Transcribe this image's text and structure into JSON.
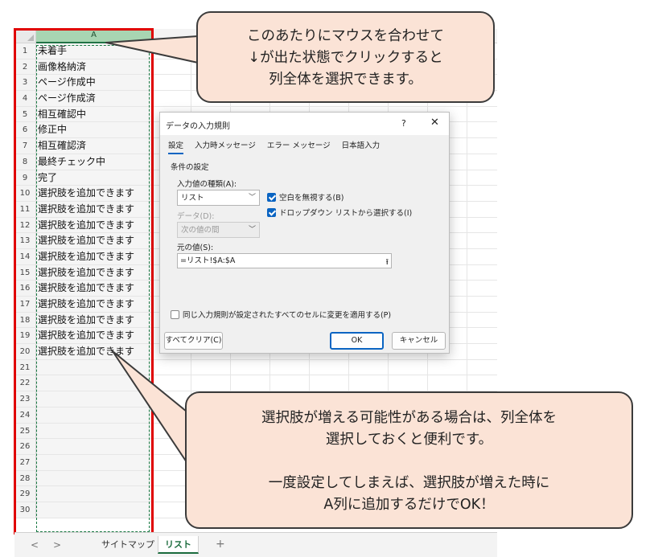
{
  "spreadsheet": {
    "column_header": "A",
    "rows": [
      {
        "num": "1",
        "value": "未着手"
      },
      {
        "num": "2",
        "value": "画像格納済"
      },
      {
        "num": "3",
        "value": "ページ作成中"
      },
      {
        "num": "4",
        "value": "ページ作成済"
      },
      {
        "num": "5",
        "value": "相互確認中"
      },
      {
        "num": "6",
        "value": "修正中"
      },
      {
        "num": "7",
        "value": "相互確認済"
      },
      {
        "num": "8",
        "value": "最終チェック中"
      },
      {
        "num": "9",
        "value": "完了"
      },
      {
        "num": "10",
        "value": "選択肢を追加できます"
      },
      {
        "num": "11",
        "value": "選択肢を追加できます"
      },
      {
        "num": "12",
        "value": "選択肢を追加できます"
      },
      {
        "num": "13",
        "value": "選択肢を追加できます"
      },
      {
        "num": "14",
        "value": "選択肢を追加できます"
      },
      {
        "num": "15",
        "value": "選択肢を追加できます"
      },
      {
        "num": "16",
        "value": "選択肢を追加できます"
      },
      {
        "num": "17",
        "value": "選択肢を追加できます"
      },
      {
        "num": "18",
        "value": "選択肢を追加できます"
      },
      {
        "num": "19",
        "value": "選択肢を追加できます"
      },
      {
        "num": "20",
        "value": "選択肢を追加できます"
      },
      {
        "num": "21",
        "value": ""
      },
      {
        "num": "22",
        "value": ""
      },
      {
        "num": "23",
        "value": ""
      },
      {
        "num": "24",
        "value": ""
      },
      {
        "num": "25",
        "value": ""
      },
      {
        "num": "26",
        "value": ""
      },
      {
        "num": "27",
        "value": ""
      },
      {
        "num": "28",
        "value": ""
      },
      {
        "num": "29",
        "value": ""
      },
      {
        "num": "30",
        "value": ""
      }
    ],
    "sheet_tabs": {
      "prev": "<",
      "next": ">",
      "tab1": "サイトマップ",
      "tab2": "リスト",
      "add": "+"
    }
  },
  "dialog": {
    "title": "データの入力規則",
    "help": "?",
    "close": "✕",
    "tabs": [
      "設定",
      "入力時メッセージ",
      "エラー メッセージ",
      "日本語入力"
    ],
    "group_label": "条件の設定",
    "allow_label": "入力値の種類(A):",
    "allow_value": "リスト",
    "ignore_blank": "空白を無視する(B)",
    "in_cell_dropdown": "ドロップダウン リストから選択する(I)",
    "data_label": "データ(D):",
    "data_value": "次の値の間",
    "source_label": "元の値(S):",
    "source_value": "=リスト!$A:$A",
    "apply_all": "同じ入力規則が設定されたすべてのセルに変更を適用する(P)",
    "clear_all": "すべてクリア(C)",
    "ok": "OK",
    "cancel": "キャンセル"
  },
  "callouts": {
    "top": [
      "このあたりにマウスを合わせて",
      "↓が出た状態でクリックすると",
      "列全体を選択できます。"
    ],
    "bottom": [
      "選択肢が増える可能性がある場合は、列全体を",
      "選択しておくと便利です。",
      "",
      "一度設定してしまえば、選択肢が増えた時に",
      "A列に追加するだけでOK！"
    ]
  },
  "colors": {
    "accent": "#0a64c2",
    "highlight": "#e00000",
    "callout_bg": "#fbe3d6",
    "excel_green": "#217346"
  }
}
